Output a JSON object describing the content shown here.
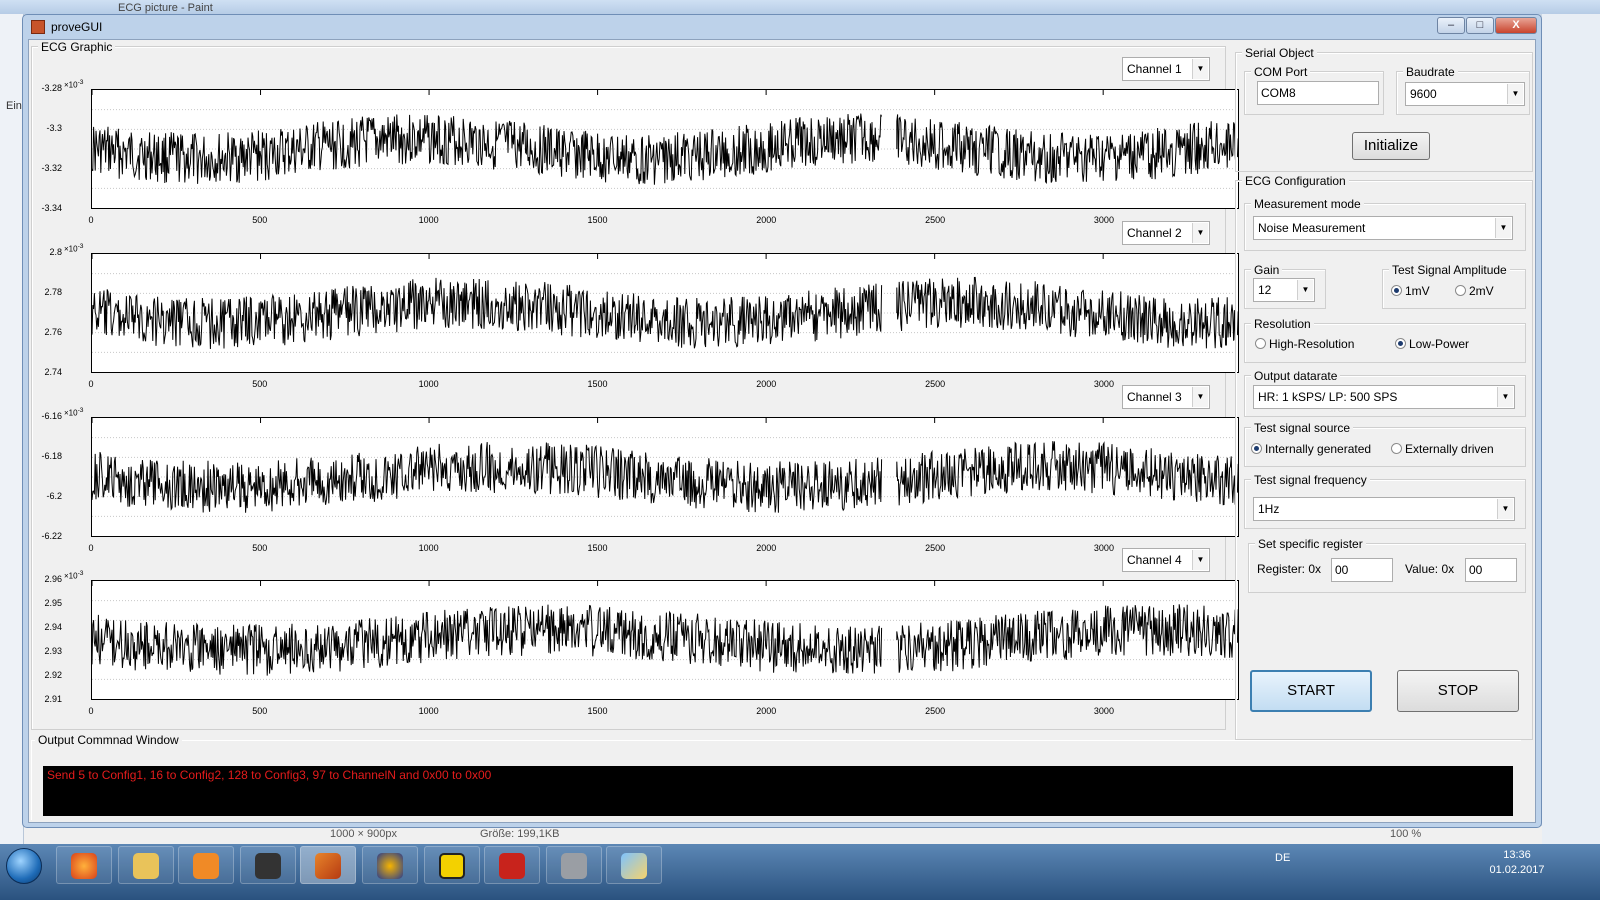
{
  "background": {
    "paint_title": "ECG picture - Paint",
    "left_text": "Ein",
    "status": {
      "dimensions": "1000 × 900px",
      "size": "Größe: 199,1KB",
      "zoom": "100 %"
    }
  },
  "window": {
    "title": "proveGUI",
    "min": "–",
    "max": "□",
    "close": "X"
  },
  "ecg_graphic": {
    "title": "ECG Graphic",
    "exponent": "×10",
    "exponent_power": "-3",
    "x_ticks": [
      "0",
      "500",
      "1000",
      "1500",
      "2000",
      "2500",
      "3000"
    ],
    "channels": [
      {
        "selector": "Channel 1",
        "y_ticks": [
          "-3.28",
          "-3.3",
          "-3.32",
          "-3.34"
        ],
        "color": "#000000"
      },
      {
        "selector": "Channel 2",
        "y_ticks": [
          "2.8",
          "2.78",
          "2.76",
          "2.74"
        ],
        "color": "#000000"
      },
      {
        "selector": "Channel 3",
        "y_ticks": [
          "-6.16",
          "-6.18",
          "-6.2",
          "-6.22"
        ],
        "color": "#000000"
      },
      {
        "selector": "Channel 4",
        "y_ticks": [
          "2.96",
          "2.95",
          "2.94",
          "2.93",
          "2.92",
          "2.91"
        ],
        "color": "#000000"
      }
    ]
  },
  "serial_object": {
    "title": "Serial Object",
    "com_port": {
      "title": "COM Port",
      "value": "COM8"
    },
    "baudrate": {
      "title": "Baudrate",
      "value": "9600"
    },
    "initialize": "Initialize"
  },
  "ecg_config": {
    "title": "ECG Configuration",
    "measurement_mode": {
      "title": "Measurement mode",
      "value": "Noise Measurement"
    },
    "gain": {
      "title": "Gain",
      "value": "12"
    },
    "test_amplitude": {
      "title": "Test Signal Amplitude",
      "opt1": "1mV",
      "opt2": "2mV",
      "selected": "1mV"
    },
    "resolution": {
      "title": "Resolution",
      "opt1": "High-Resolution",
      "opt2": "Low-Power",
      "selected": "Low-Power"
    },
    "output_datarate": {
      "title": "Output datarate",
      "value": "HR: 1 kSPS/ LP: 500 SPS"
    },
    "test_source": {
      "title": "Test signal source",
      "opt1": "Internally generated",
      "opt2": "Externally driven",
      "selected": "Internally generated"
    },
    "test_frequency": {
      "title": "Test signal frequency",
      "value": "1Hz"
    },
    "register": {
      "title": "Set specific register",
      "register_label": "Register: 0x",
      "register_value": "00",
      "value_label": "Value: 0x",
      "value_value": "00"
    }
  },
  "actions": {
    "start": "START",
    "stop": "STOP"
  },
  "output": {
    "title": "Output Commnad Window",
    "message": "Send 5 to Config1, 16 to Config2, 128 to Config3, 97  to ChannelN and 0x00 to 0x00"
  },
  "taskbar": {
    "apps": [
      "start-orb-icon",
      "firefox-icon",
      "explorer-icon",
      "media-player-icon",
      "inkscape-icon",
      "matlab-icon",
      "audacity-icon",
      "pdf-icon",
      "solidworks-icon",
      "virtualbox-icon",
      "paint-icon"
    ],
    "language": "DE",
    "time": "13:36",
    "date": "01.02.2017"
  }
}
